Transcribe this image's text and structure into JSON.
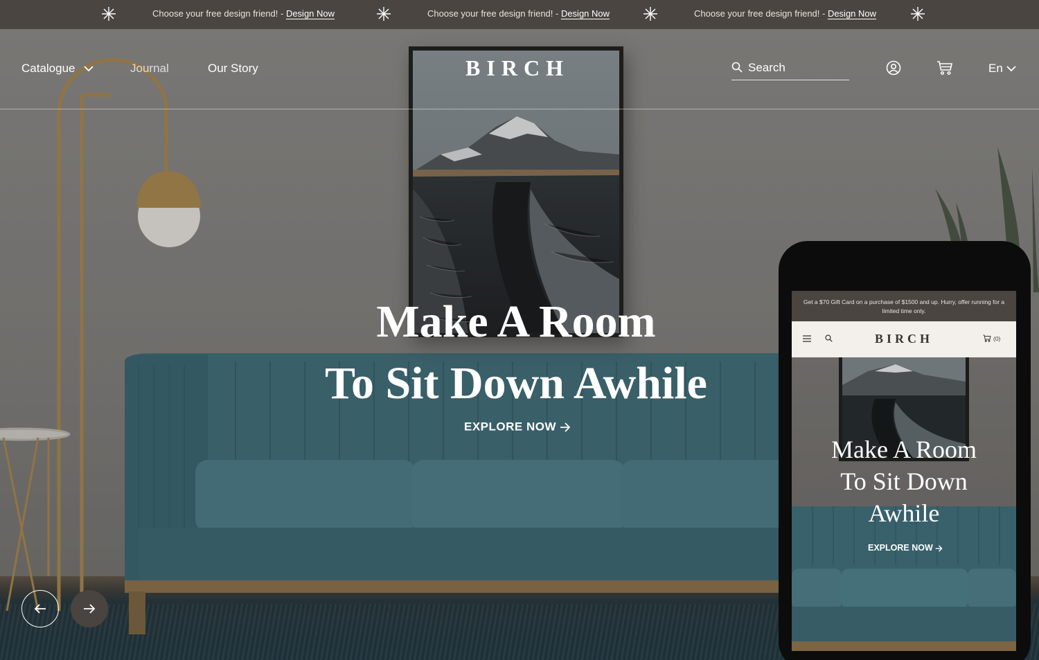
{
  "announcement": {
    "items": [
      {
        "text": "Choose your free design friend! - ",
        "link": "Design Now"
      },
      {
        "text": "Choose your free design friend! - ",
        "link": "Design Now"
      },
      {
        "text": "Choose your free design friend! - ",
        "link": "Design Now"
      }
    ]
  },
  "nav": {
    "catalogue": "Catalogue",
    "journal": "Journal",
    "our_story": "Our Story"
  },
  "brand": {
    "logo": "BIRCH"
  },
  "search": {
    "placeholder": "Search"
  },
  "language": {
    "current": "En"
  },
  "hero": {
    "headline_line1": "Make A Room",
    "headline_line2": "To Sit Down Awhile",
    "cta": "EXPLORE NOW"
  },
  "mobile": {
    "announcement": "Get a $70 Gift Card on a purchase of $1500 and up. Hurry, offer running for a limited time only.",
    "logo": "BIRCH",
    "cart_count": "(0)",
    "headline_line1": "Make A Room",
    "headline_line2": "To Sit Down",
    "headline_line3": "Awhile",
    "cta": "EXPLORE NOW"
  },
  "icons": {
    "sparkle": "sparkle-icon",
    "search": "search-icon",
    "account": "user-circle-icon",
    "cart": "cart-icon",
    "chevron": "chevron-down-icon",
    "prev": "arrow-left-icon",
    "next": "arrow-right-icon",
    "menu": "hamburger-icon"
  },
  "colors": {
    "announcement_bg": "#4a4540",
    "sofa": "#3d6b78",
    "mobile_header_bg": "#f3f0eb",
    "text_light": "#ffffff"
  }
}
